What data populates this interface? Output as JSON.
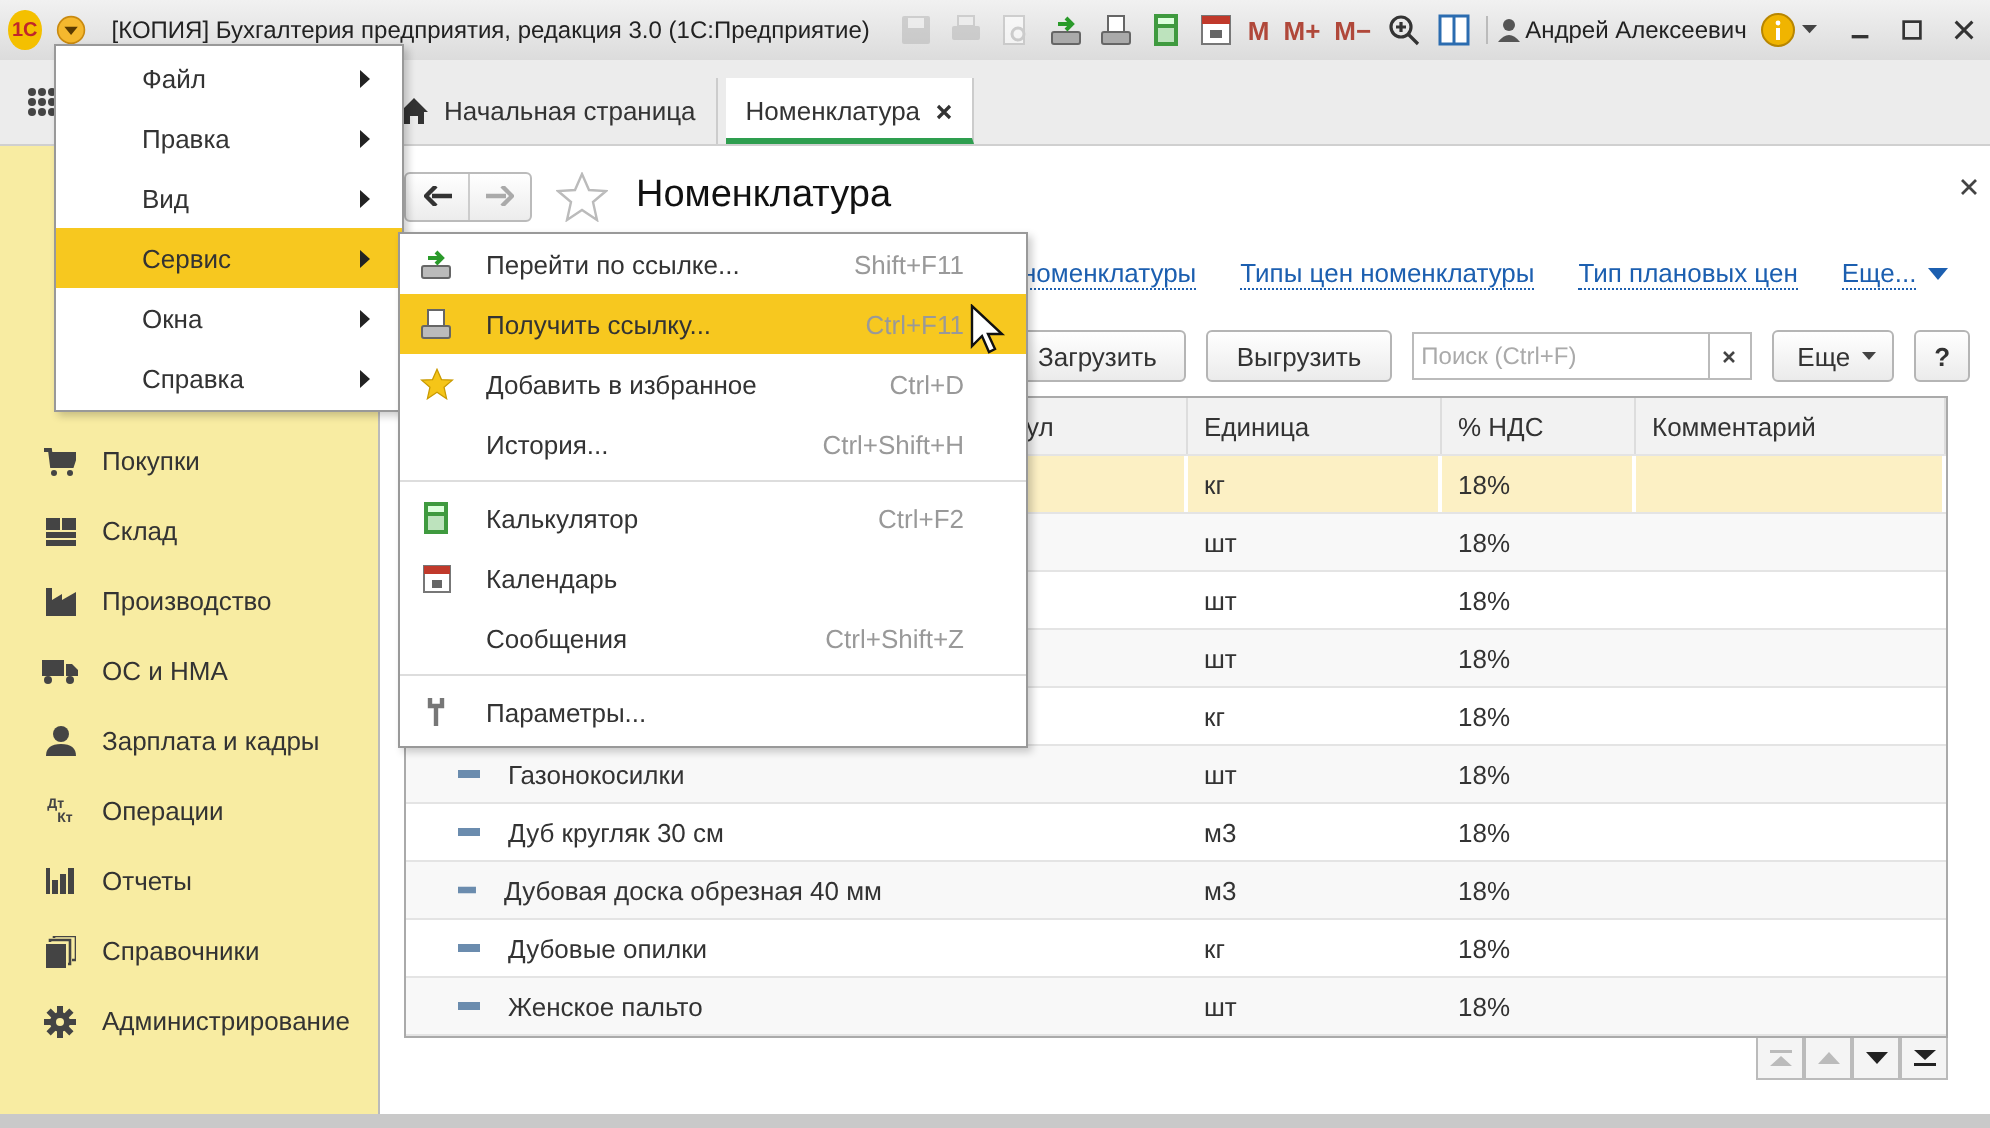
{
  "window": {
    "logo": "1С",
    "title": "[КОПИЯ] Бухгалтерия предприятия, редакция 3.0  (1С:Предприятие)",
    "toolbar": [
      {
        "kind": "save",
        "disabled": true
      },
      {
        "kind": "print",
        "disabled": true
      },
      {
        "kind": "preview",
        "disabled": true
      },
      {
        "kind": "golink",
        "disabled": false
      },
      {
        "kind": "getlink",
        "disabled": false
      },
      {
        "kind": "calc",
        "disabled": false
      },
      {
        "kind": "calendar",
        "disabled": false
      }
    ],
    "memory_buttons": [
      "M",
      "M+",
      "M−"
    ],
    "user": "Андрей Алексеевич"
  },
  "tabs": [
    {
      "label": "Начальная страница",
      "kind": "home",
      "selected": false
    },
    {
      "label": "Номенклатура",
      "kind": "page",
      "selected": true
    }
  ],
  "sidebar": {
    "items": [
      {
        "label": "Покупки",
        "kind": "cart"
      },
      {
        "label": "Склад",
        "kind": "grid"
      },
      {
        "label": "Производство",
        "kind": "factory"
      },
      {
        "label": "ОС и НМА",
        "kind": "truck"
      },
      {
        "label": "Зарплата и кадры",
        "kind": "person"
      },
      {
        "label": "Операции",
        "kind": "dtkt",
        "icon_text": [
          "Дт",
          "Кт"
        ]
      },
      {
        "label": "Отчеты",
        "kind": "bars"
      },
      {
        "label": "Справочники",
        "kind": "books"
      },
      {
        "label": "Администрирование",
        "kind": "gear"
      }
    ]
  },
  "page": {
    "title": "Номенклатура",
    "favorite": false,
    "links": [
      "номенклатуры",
      "Типы цен номенклатуры",
      "Тип плановых цен",
      "Еще..."
    ],
    "buttons": [
      "Загрузить",
      "Выгрузить"
    ],
    "search": {
      "placeholder": "Поиск (Ctrl+F)"
    },
    "more_button": "Еще",
    "help_button": "?"
  },
  "table": {
    "columns": [
      "ул",
      "Единица",
      "% НДС",
      "Комментарий"
    ],
    "rows": [
      {
        "unit": "кг",
        "vat": "18%",
        "selected": true
      },
      {
        "unit": "шт",
        "vat": "18%",
        "selected": false
      },
      {
        "unit": "шт",
        "vat": "18%",
        "selected": false
      },
      {
        "unit": "шт",
        "vat": "18%",
        "selected": false
      },
      {
        "unit": "кг",
        "vat": "18%",
        "selected": false
      },
      {
        "name": "Газонокосилки",
        "unit": "шт",
        "vat": "18%",
        "selected": false
      },
      {
        "name": "Дуб кругляк 30 см",
        "unit": "м3",
        "vat": "18%",
        "selected": false
      },
      {
        "name": "Дубовая доска обрезная 40 мм",
        "unit": "м3",
        "vat": "18%",
        "selected": false
      },
      {
        "name": "Дубовые опилки",
        "unit": "кг",
        "vat": "18%",
        "selected": false
      },
      {
        "name": "Женское пальто",
        "unit": "шт",
        "vat": "18%",
        "selected": false
      }
    ]
  },
  "main_menu": {
    "items": [
      {
        "label": "Файл",
        "selected": false
      },
      {
        "label": "Правка",
        "selected": false
      },
      {
        "label": "Вид",
        "selected": false
      },
      {
        "label": "Сервис",
        "selected": true
      },
      {
        "label": "Окна",
        "selected": false
      },
      {
        "label": "Справка",
        "selected": false
      }
    ]
  },
  "submenu": {
    "groups": [
      [
        {
          "label": "Перейти по ссылке...",
          "shortcut": "Shift+F11",
          "kind": "golink",
          "selected": false
        },
        {
          "label": "Получить ссылку...",
          "shortcut": "Ctrl+F11",
          "kind": "getlink",
          "selected": true
        },
        {
          "label": "Добавить в избранное",
          "shortcut": "Ctrl+D",
          "kind": "star",
          "selected": false
        },
        {
          "label": "История...",
          "shortcut": "Ctrl+Shift+H",
          "kind": "plain",
          "selected": false
        }
      ],
      [
        {
          "label": "Калькулятор",
          "shortcut": "Ctrl+F2",
          "kind": "calc",
          "selected": false
        },
        {
          "label": "Календарь",
          "kind": "calendar",
          "selected": false
        },
        {
          "label": "Сообщения",
          "shortcut": "Ctrl+Shift+Z",
          "kind": "plain",
          "selected": false
        }
      ],
      [
        {
          "label": "Параметры...",
          "kind": "wrench",
          "selected": false
        }
      ]
    ]
  }
}
